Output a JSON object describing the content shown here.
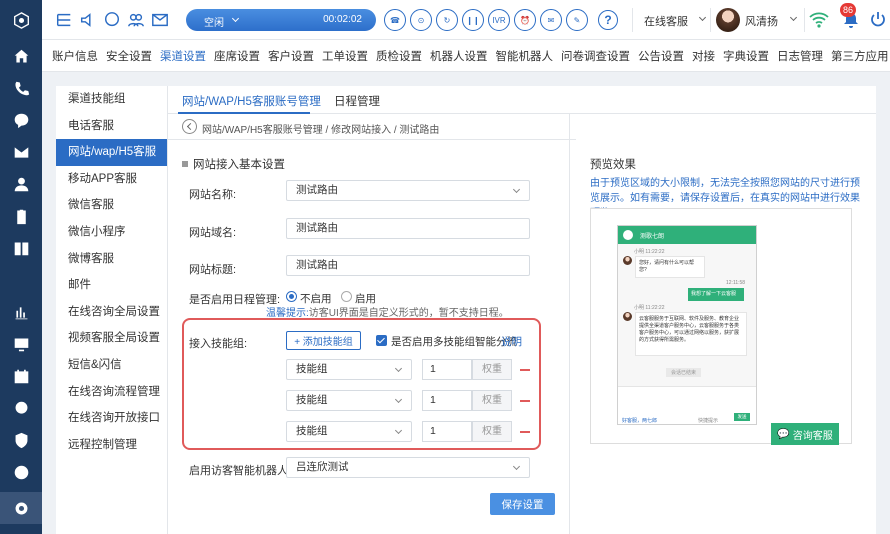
{
  "topbar": {
    "status": "空闲",
    "timer": "00:02:02",
    "ivr": "IVR",
    "online_status": "在线客服",
    "user_name": "风清扬",
    "notification_count": "86"
  },
  "menu": [
    "账户信息",
    "安全设置",
    "渠道设置",
    "座席设置",
    "客户设置",
    "工单设置",
    "质检设置",
    "机器人设置",
    "智能机器人",
    "问卷调查设置",
    "公告设置",
    "对接",
    "字典设置",
    "日志管理",
    "第三方应用"
  ],
  "subnav": [
    "渠道技能组",
    "电话客服",
    "网站/wap/H5客服",
    "移动APP客服",
    "微信客服",
    "微信小程序",
    "微博客服",
    "邮件",
    "在线咨询全局设置",
    "视频客服全局设置",
    "短信&闪信",
    "在线咨询流程管理",
    "在线咨询开放接口",
    "远程控制管理"
  ],
  "tabs": [
    "网站/WAP/H5客服账号管理",
    "日程管理"
  ],
  "breadcrumb": "网站/WAP/H5客服账号管理 / 修改网站接入 / 测试路由",
  "form": {
    "section_title": "网站接入基本设置",
    "site_name_label": "网站名称:",
    "site_name": "测试路由",
    "domain_label": "网站域名:",
    "domain": "测试路由",
    "site_title_label": "网站标题:",
    "site_title": "测试路由",
    "schedule_label": "是否启用日程管理:",
    "schedule_off": "不启用",
    "schedule_on": "启用",
    "tip_prefix": "温馨提示:",
    "tip_text": "访客UI界面是自定义形式的，暂不支持日程。",
    "skill_label": "接入技能组:",
    "add_skill": "+ 添加技能组",
    "smart_route_label": "是否启用多技能组智能分流",
    "explain": "说明",
    "skill_rows": [
      {
        "skill": "技能组",
        "value": "1",
        "weight": "权重"
      },
      {
        "skill": "技能组",
        "value": "1",
        "weight": "权重"
      },
      {
        "skill": "技能组",
        "value": "1",
        "weight": "权重"
      }
    ],
    "robot_label": "启用访客智能机器人:",
    "robot": "吕连欣测试",
    "save": "保存设置"
  },
  "preview": {
    "title": "预览效果",
    "desc": "由于预览区域的大小限制，无法完全按照您网站的尺寸进行预览展示。如有需要，请保存设置后，在真实的网站中进行效果预览。",
    "phone_title": "测歌七朗",
    "t1": "小明 11:22:22",
    "m1": "您好，请问有什么可以帮您?",
    "t2": "12:11:58",
    "m2": "我想了解一下云客服",
    "t3": "小明 11:22:22",
    "m3": "云客服服务于互联网、软件及服务、教育企业提供全渠道客户服务中心，云客服服务于各类客户服务中心，可以通过网络以服务，获扩展的方式获得所需服务。",
    "ended": "会话已结束",
    "footer_left": "好客服，两七郎",
    "footer_right": "快捷提示",
    "send": "发送",
    "consult_button": "咨询客服"
  }
}
